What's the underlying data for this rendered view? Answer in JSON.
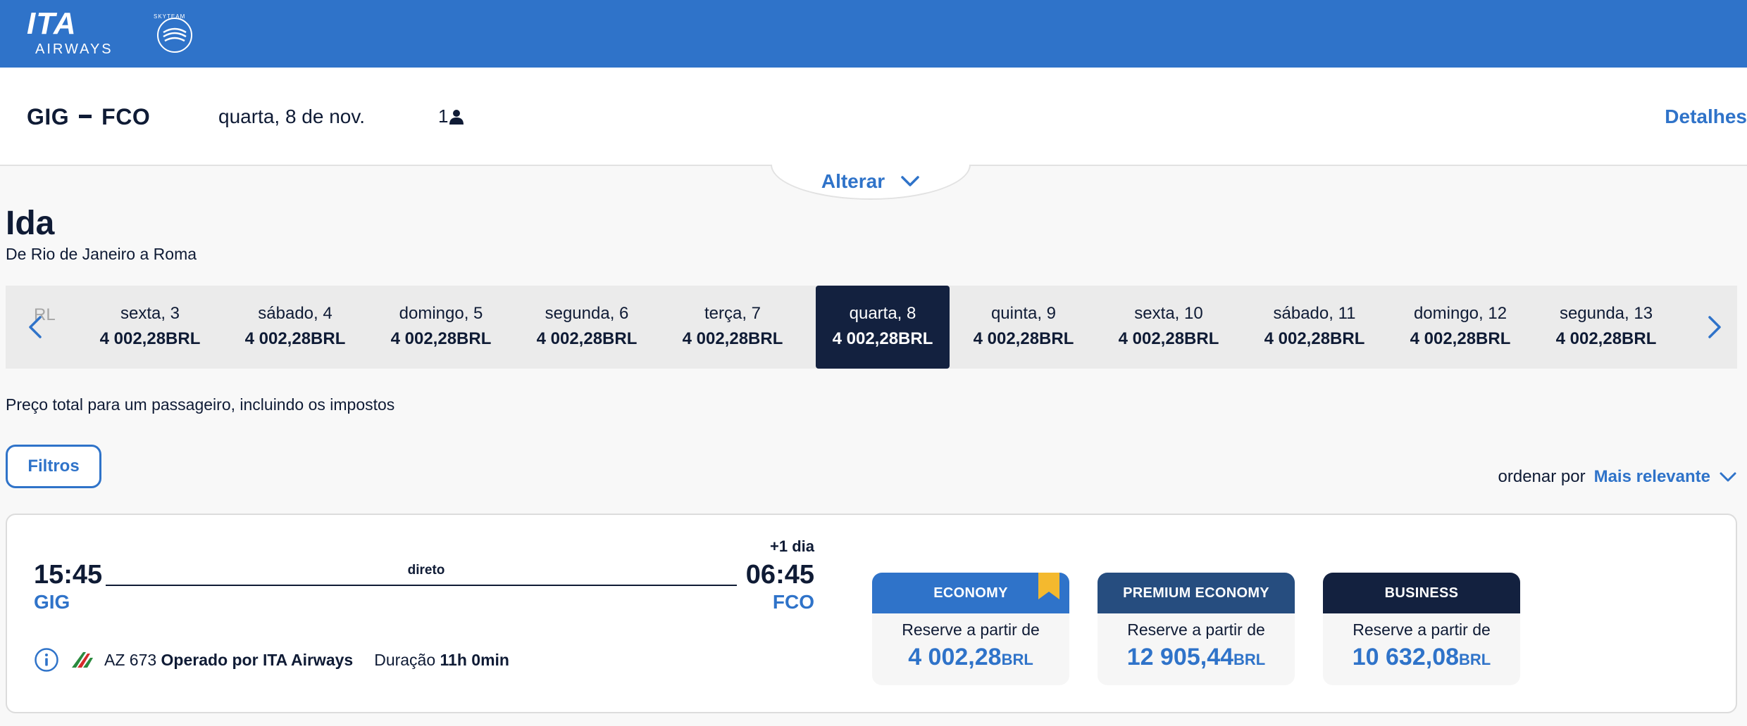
{
  "header": {
    "logo": {
      "brand": "ITA",
      "sub": "AIRWAYS",
      "alliance": "SKYTEAM"
    }
  },
  "search": {
    "origin": "GIG",
    "destination": "FCO",
    "date": "quarta, 8 de nov.",
    "passengers": "1",
    "details_label": "Detalhes",
    "alter_label": "Alterar"
  },
  "trip": {
    "title": "Ida",
    "subtitle": "De Rio de Janeiro a Roma"
  },
  "date_carousel": {
    "partial_prev": "RL",
    "days": [
      {
        "label": "sexta, 3",
        "price": "4 002,28BRL",
        "selected": false
      },
      {
        "label": "sábado, 4",
        "price": "4 002,28BRL",
        "selected": false
      },
      {
        "label": "domingo, 5",
        "price": "4 002,28BRL",
        "selected": false
      },
      {
        "label": "segunda, 6",
        "price": "4 002,28BRL",
        "selected": false
      },
      {
        "label": "terça, 7",
        "price": "4 002,28BRL",
        "selected": false
      },
      {
        "label": "quarta, 8",
        "price": "4 002,28BRL",
        "selected": true
      },
      {
        "label": "quinta, 9",
        "price": "4 002,28BRL",
        "selected": false
      },
      {
        "label": "sexta, 10",
        "price": "4 002,28BRL",
        "selected": false
      },
      {
        "label": "sábado, 11",
        "price": "4 002,28BRL",
        "selected": false
      },
      {
        "label": "domingo, 12",
        "price": "4 002,28BRL",
        "selected": false
      },
      {
        "label": "segunda, 13",
        "price": "4 002,28BRL",
        "selected": false
      }
    ]
  },
  "price_note": "Preço total para um passageiro, incluindo os impostos",
  "filters_label": "Filtros",
  "sort": {
    "label": "ordenar por",
    "value": "Mais relevante"
  },
  "flight": {
    "departure_time": "15:45",
    "departure_airport": "GIG",
    "arrival_time": "06:45",
    "arrival_airport": "FCO",
    "day_offset": "+1 dia",
    "stops": "direto",
    "flight_number": "AZ 673",
    "operated_by": "Operado por ITA Airways",
    "duration_label": "Duração",
    "duration": "11h 0min",
    "fares": [
      {
        "cabin": "ECONOMY",
        "from_label": "Reserve a partir de",
        "amount": "4 002,28",
        "currency": "BRL"
      },
      {
        "cabin": "PREMIUM ECONOMY",
        "from_label": "Reserve a partir de",
        "amount": "12 905,44",
        "currency": "BRL"
      },
      {
        "cabin": "BUSINESS",
        "from_label": "Reserve a partir de",
        "amount": "10 632,08",
        "currency": "BRL"
      }
    ]
  },
  "colors": {
    "brand_blue": "#2f73c9",
    "navy": "#13213f",
    "premium": "#264d7f",
    "bookmark": "#f4b92e"
  }
}
